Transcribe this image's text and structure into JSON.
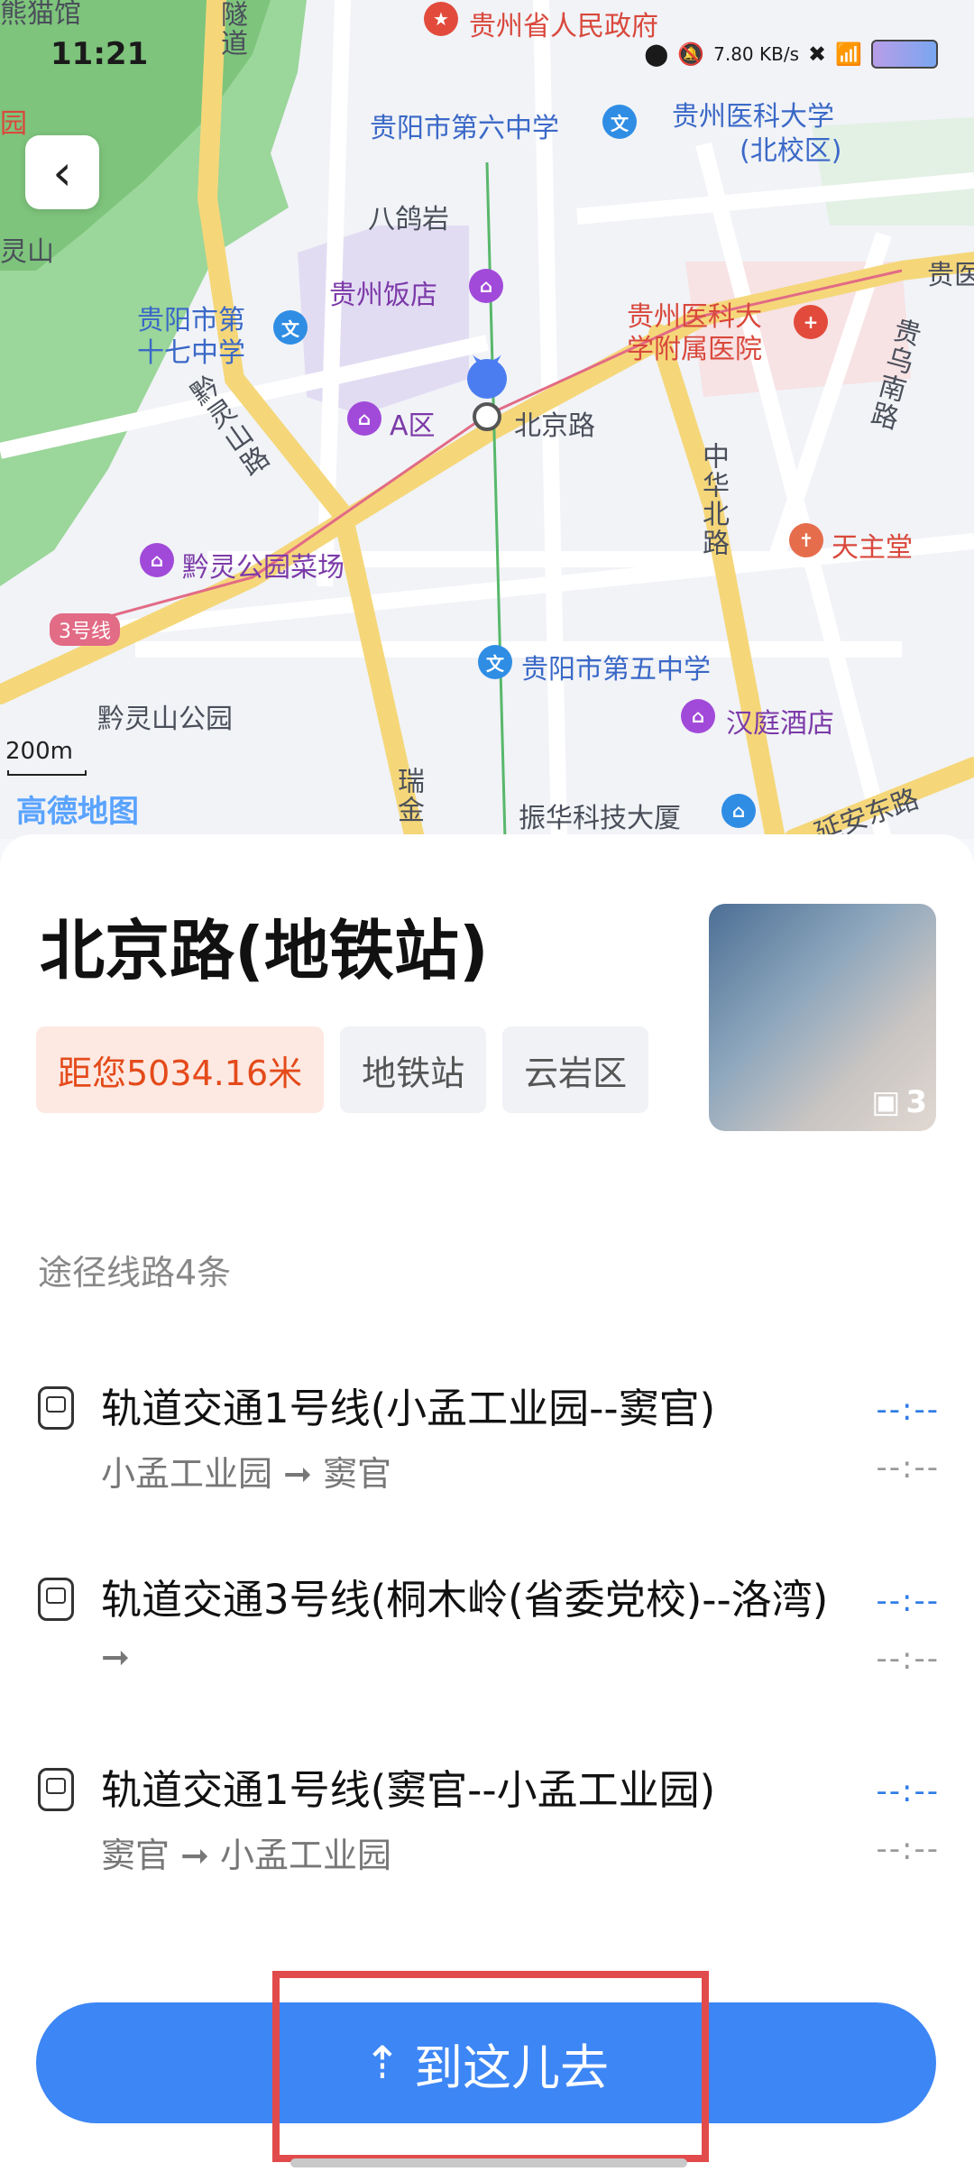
{
  "status": {
    "time": "11:21",
    "net_speed": "7.80 KB/s"
  },
  "map": {
    "labels": {
      "gov": "贵州省人民政府",
      "school6": "贵阳市第六中学",
      "gmu": "贵州医科大学",
      "gmu2": "(北校区)",
      "bageyan": "八鸽岩",
      "hotel_guizhou": "贵州饭店",
      "school17a": "贵阳市第",
      "school17b": "十七中学",
      "gmu_hospital1": "贵州医科大",
      "gmu_hospital2": "学附属医院",
      "a_area": "A区",
      "beijing_road": "北京路",
      "qianling_road": "黔灵山路",
      "zhonghua_road": "中华北路",
      "guiwu_road": "贵乌南路",
      "church": "天主堂",
      "market": "黔灵公园菜场",
      "line3": "3号线",
      "school5": "贵阳市第五中学",
      "park": "黔灵山公园",
      "hanting": "汉庭酒店",
      "zhenhua": "振华科技大厦",
      "yanan_road": "延安东路",
      "tunnel": "隧道",
      "scale": "200m",
      "logo": "高德地图",
      "ruijin": "瑞金",
      "guiyi": "贵医",
      "panda": "熊猫馆",
      "yuan": "园",
      "shan": "灵山"
    }
  },
  "card": {
    "title": "北京路(地铁站)",
    "tags": [
      "距您5034.16米",
      "地铁站",
      "云岩区"
    ],
    "photo_count": "3",
    "routes_title": "途径线路4条",
    "routes": [
      {
        "name": "轨道交通1号线(小孟工业园--窦官)",
        "sub": "小孟工业园 ➞ 窦官",
        "time": "--:--",
        "time2": "--:--"
      },
      {
        "name": "轨道交通3号线(桐木岭(省委党校)--洛湾)",
        "sub": "➞",
        "time": "--:--",
        "time2": "--:--"
      },
      {
        "name": "轨道交通1号线(窦官--小孟工业园)",
        "sub": "窦官 ➞ 小孟工业园",
        "time": "--:--",
        "time2": "--:--"
      }
    ],
    "go_button": "到这儿去"
  }
}
